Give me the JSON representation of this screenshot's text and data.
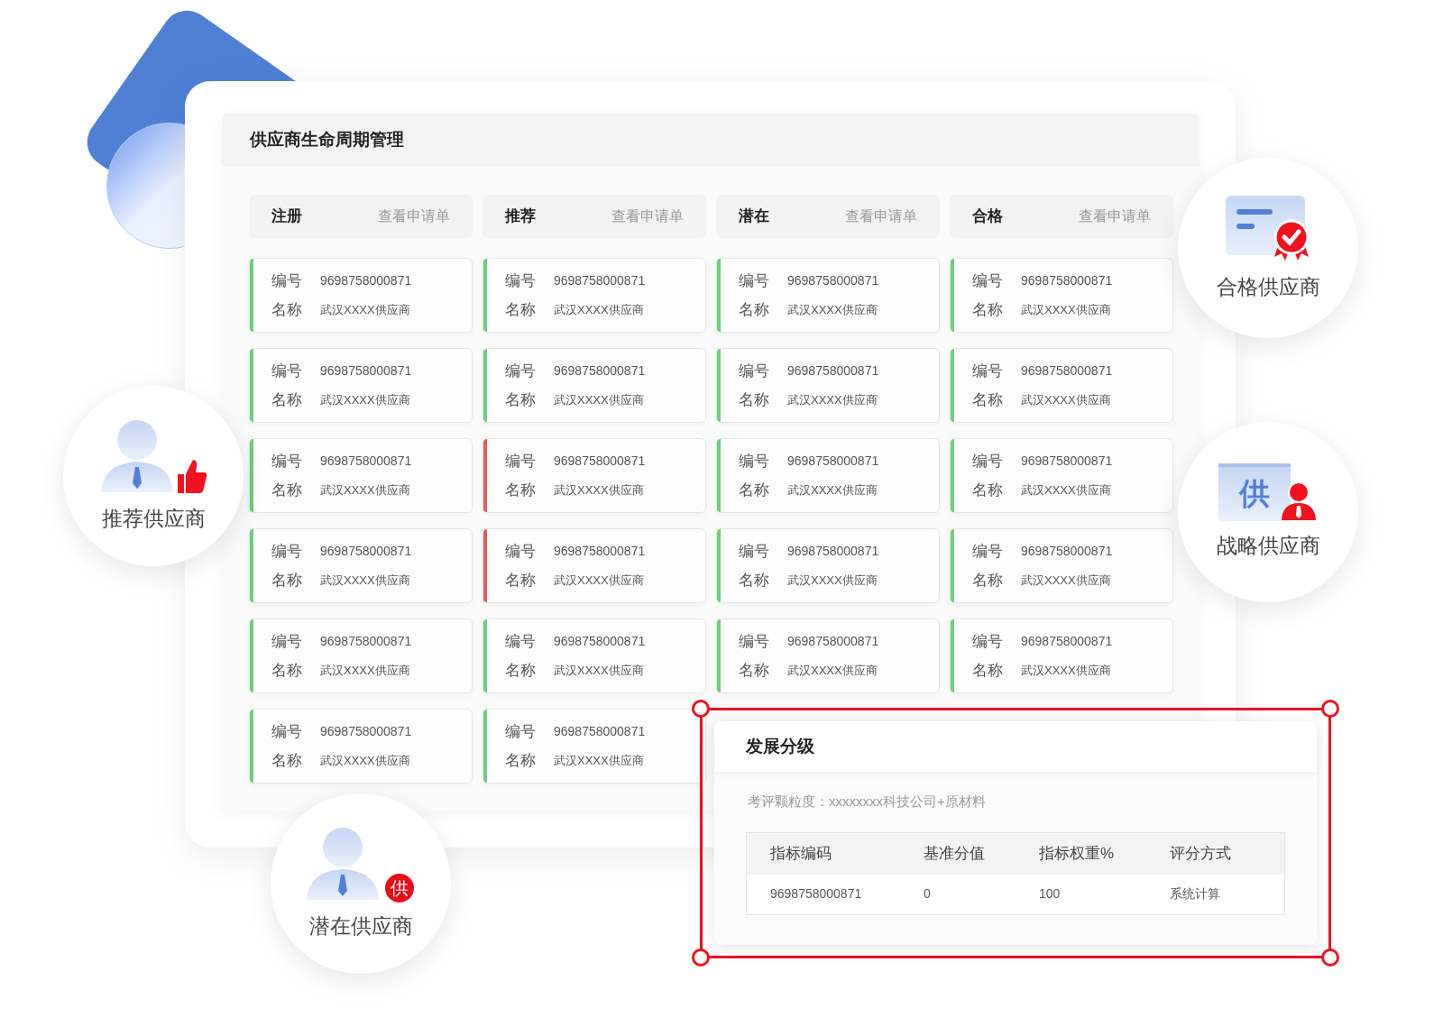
{
  "title": "供应商生命周期管理",
  "columns": [
    {
      "title": "注册",
      "link": "查看申请单",
      "cards": [
        {
          "id_label": "编号",
          "id": "9698758000871",
          "name_label": "名称",
          "name": "武汉XXXX供应商",
          "color": "#6ccf7c"
        },
        {
          "id_label": "编号",
          "id": "9698758000871",
          "name_label": "名称",
          "name": "武汉XXXX供应商",
          "color": "#6ccf7c"
        },
        {
          "id_label": "编号",
          "id": "9698758000871",
          "name_label": "名称",
          "name": "武汉XXXX供应商",
          "color": "#6ccf7c"
        },
        {
          "id_label": "编号",
          "id": "9698758000871",
          "name_label": "名称",
          "name": "武汉XXXX供应商",
          "color": "#6ccf7c"
        },
        {
          "id_label": "编号",
          "id": "9698758000871",
          "name_label": "名称",
          "name": "武汉XXXX供应商",
          "color": "#6ccf7c"
        },
        {
          "id_label": "编号",
          "id": "9698758000871",
          "name_label": "名称",
          "name": "武汉XXXX供应商",
          "color": "#6ccf7c"
        }
      ]
    },
    {
      "title": "推荐",
      "link": "查看申请单",
      "cards": [
        {
          "id_label": "编号",
          "id": "9698758000871",
          "name_label": "名称",
          "name": "武汉XXXX供应商",
          "color": "#6ccf7c"
        },
        {
          "id_label": "编号",
          "id": "9698758000871",
          "name_label": "名称",
          "name": "武汉XXXX供应商",
          "color": "#6ccf7c"
        },
        {
          "id_label": "编号",
          "id": "9698758000871",
          "name_label": "名称",
          "name": "武汉XXXX供应商",
          "color": "#f0565e"
        },
        {
          "id_label": "编号",
          "id": "9698758000871",
          "name_label": "名称",
          "name": "武汉XXXX供应商",
          "color": "#f0565e"
        },
        {
          "id_label": "编号",
          "id": "9698758000871",
          "name_label": "名称",
          "name": "武汉XXXX供应商",
          "color": "#6ccf7c"
        },
        {
          "id_label": "编号",
          "id": "9698758000871",
          "name_label": "名称",
          "name": "武汉XXXX供应商",
          "color": "#6ccf7c"
        }
      ]
    },
    {
      "title": "潜在",
      "link": "查看申请单",
      "cards": [
        {
          "id_label": "编号",
          "id": "9698758000871",
          "name_label": "名称",
          "name": "武汉XXXX供应商",
          "color": "#6ccf7c"
        },
        {
          "id_label": "编号",
          "id": "9698758000871",
          "name_label": "名称",
          "name": "武汉XXXX供应商",
          "color": "#6ccf7c"
        },
        {
          "id_label": "编号",
          "id": "9698758000871",
          "name_label": "名称",
          "name": "武汉XXXX供应商",
          "color": "#6ccf7c"
        },
        {
          "id_label": "编号",
          "id": "9698758000871",
          "name_label": "名称",
          "name": "武汉XXXX供应商",
          "color": "#6ccf7c"
        },
        {
          "id_label": "编号",
          "id": "9698758000871",
          "name_label": "名称",
          "name": "武汉XXXX供应商",
          "color": "#6ccf7c"
        }
      ]
    },
    {
      "title": "合格",
      "link": "查看申请单",
      "cards": [
        {
          "id_label": "编号",
          "id": "9698758000871",
          "name_label": "名称",
          "name": "武汉XXXX供应商",
          "color": "#6ccf7c"
        },
        {
          "id_label": "编号",
          "id": "9698758000871",
          "name_label": "名称",
          "name": "武汉XXXX供应商",
          "color": "#6ccf7c"
        },
        {
          "id_label": "编号",
          "id": "9698758000871",
          "name_label": "名称",
          "name": "武汉XXXX供应商",
          "color": "#6ccf7c"
        },
        {
          "id_label": "编号",
          "id": "9698758000871",
          "name_label": "名称",
          "name": "武汉XXXX供应商",
          "color": "#6ccf7c"
        },
        {
          "id_label": "编号",
          "id": "9698758000871",
          "name_label": "名称",
          "name": "武汉XXXX供应商",
          "color": "#6ccf7c"
        }
      ]
    }
  ],
  "badges": [
    {
      "kind": "recommend",
      "label": "推荐供应商"
    },
    {
      "kind": "potential",
      "label": "潜在供应商",
      "icon_text": "供"
    },
    {
      "kind": "qualified",
      "label": "合格供应商"
    },
    {
      "kind": "strategic",
      "label": "战略供应商",
      "icon_text": "供"
    }
  ],
  "popup": {
    "title": "发展分级",
    "subtitle": "考评颗粒度：xxxxxxxx科技公司+原材料",
    "columns": [
      "指标编码",
      "基准分值",
      "指标权重%",
      "评分方式"
    ],
    "rows": [
      [
        "9698758000871",
        "0",
        "100",
        "系统计算"
      ]
    ]
  }
}
